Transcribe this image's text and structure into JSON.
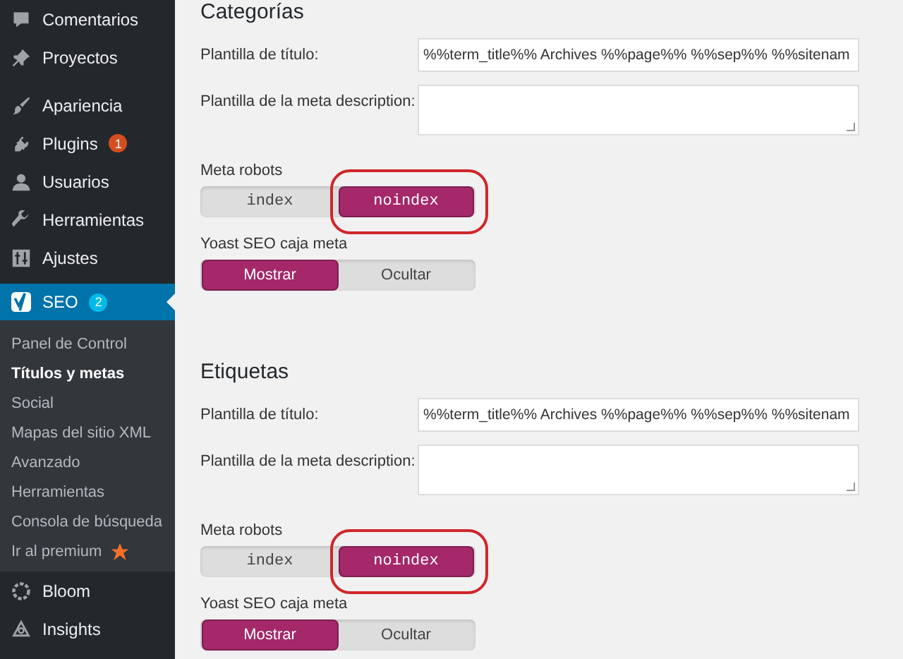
{
  "sidebar": {
    "groups": [
      {
        "items": [
          {
            "label": "Comentarios",
            "selected": false
          },
          {
            "label": "Proyectos",
            "selected": false
          }
        ]
      },
      {
        "items": [
          {
            "label": "Apariencia",
            "selected": false
          },
          {
            "label": "Plugins",
            "selected": false,
            "badge": "1"
          },
          {
            "label": "Usuarios",
            "selected": false
          },
          {
            "label": "Herramientas",
            "selected": false
          },
          {
            "label": "Ajustes",
            "selected": false
          },
          {
            "label": "SEO",
            "selected": true,
            "badge": "2",
            "submenu": [
              {
                "label": "Panel de Control",
                "selected": false
              },
              {
                "label": "Títulos y metas",
                "selected": true
              },
              {
                "label": "Social",
                "selected": false
              },
              {
                "label": "Mapas del sitio XML",
                "selected": false
              },
              {
                "label": "Avanzado",
                "selected": false
              },
              {
                "label": "Herramientas",
                "selected": false
              },
              {
                "label": "Consola de búsqueda",
                "selected": false
              },
              {
                "label": "Ir al premium",
                "selected": false,
                "star": true
              }
            ]
          },
          {
            "label": "Bloom",
            "selected": false
          },
          {
            "label": "Insights",
            "selected": false
          }
        ]
      }
    ]
  },
  "sections": [
    {
      "heading": "Categorías",
      "title_label": "Plantilla de título:",
      "title_value": "%%term_title%% Archives %%page%% %%sep%% %%sitenam",
      "desc_label": "Plantilla de la meta description:",
      "robots_label": "Meta robots",
      "robots_options": [
        {
          "label": "index",
          "selected": false,
          "circled": false
        },
        {
          "label": "noindex",
          "selected": true,
          "circled": true
        }
      ],
      "metabox_label": "Yoast SEO caja meta",
      "metabox_options": [
        {
          "label": "Mostrar",
          "selected": true
        },
        {
          "label": "Ocultar",
          "selected": false
        }
      ]
    },
    {
      "heading": "Etiquetas",
      "title_label": "Plantilla de título:",
      "title_value": "%%term_title%% Archives %%page%% %%sep%% %%sitenam",
      "desc_label": "Plantilla de la meta description:",
      "robots_label": "Meta robots",
      "robots_options": [
        {
          "label": "index",
          "selected": false,
          "circled": false
        },
        {
          "label": "noindex",
          "selected": true,
          "circled": true
        }
      ],
      "metabox_label": "Yoast SEO caja meta",
      "metabox_options": [
        {
          "label": "Mostrar",
          "selected": true
        },
        {
          "label": "Ocultar",
          "selected": false
        }
      ]
    }
  ]
}
